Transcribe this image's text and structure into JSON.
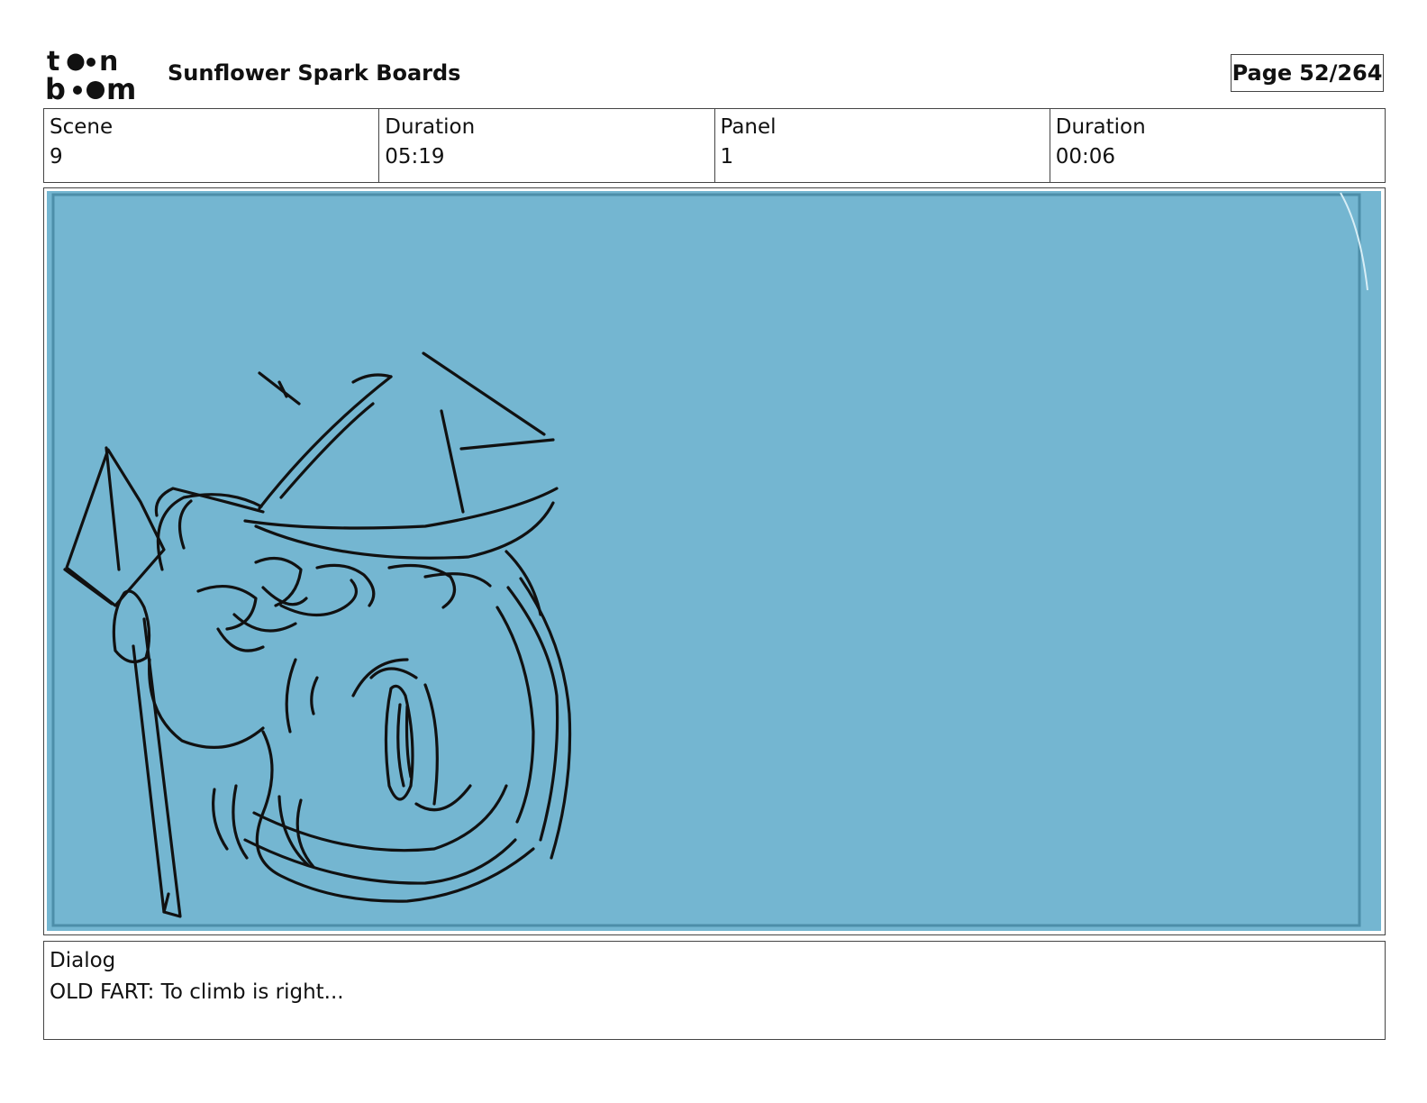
{
  "header": {
    "logo_text_top": "toon",
    "logo_text_bottom": "boom",
    "title": "Sunflower Spark Boards",
    "page_label": "Page",
    "page_value": "52/264"
  },
  "info": {
    "scene_label": "Scene",
    "scene_value": "9",
    "scene_duration_label": "Duration",
    "scene_duration_value": "05:19",
    "panel_label": "Panel",
    "panel_value": "1",
    "panel_duration_label": "Duration",
    "panel_duration_value": "00:06"
  },
  "panel": {
    "background_color": "#74b6d1",
    "inner_border_color": "#4d8ea9",
    "line_color": "#111111"
  },
  "dialog": {
    "label": "Dialog",
    "text": "OLD FART: To climb is right..."
  },
  "colors": {
    "border": "#444444",
    "text": "#111111",
    "page_bg": "#ffffff"
  }
}
